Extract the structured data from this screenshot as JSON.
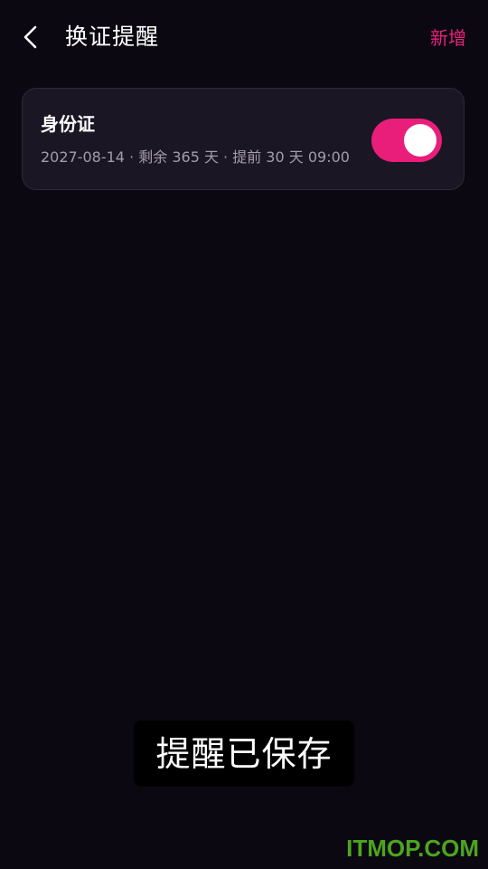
{
  "header": {
    "title": "换证提醒",
    "add_label": "新增",
    "back_icon": "chevron-left-icon"
  },
  "reminders": [
    {
      "title": "身份证",
      "meta": "2027-08-14 · 剩余 365 天 · 提前 30 天 09:00",
      "enabled": true
    }
  ],
  "toast": {
    "text": "提醒已保存"
  },
  "watermark": {
    "text": "ITMOP.COM"
  },
  "colors": {
    "background": "#0b0812",
    "card": "#1b1624",
    "accent": "#e91e7a",
    "muted_text": "#a39cad",
    "watermark": "#4ca51e"
  }
}
